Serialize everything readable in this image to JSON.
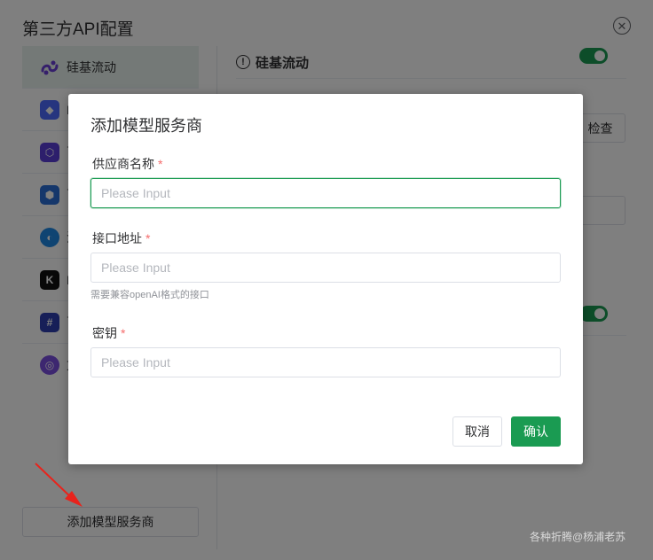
{
  "panel": {
    "title": "第三方API配置",
    "sidebar": {
      "items": [
        {
          "label": "硅基流动",
          "icon": "siliconflow-icon",
          "color": "#6b3fd6",
          "active": true
        },
        {
          "label": "D",
          "icon": "deepseek-icon",
          "color": "#4d6bfe"
        },
        {
          "label": "百",
          "icon": "provider-3-icon",
          "color": "#5b3fd9"
        },
        {
          "label": "百",
          "icon": "provider-4-icon",
          "color": "#2b6fd6"
        },
        {
          "label": "混",
          "icon": "provider-5-icon",
          "color": "#1e88e5"
        },
        {
          "label": "K",
          "icon": "kimi-icon",
          "color": "#111111"
        },
        {
          "label": "百",
          "icon": "provider-7-icon",
          "color": "#2f3fb0"
        },
        {
          "label": "文",
          "icon": "provider-8-icon",
          "color": "#7b4fe0"
        }
      ],
      "add_button": "添加模型服务商"
    },
    "content": {
      "title": "硅基流动",
      "check_button": "检查"
    }
  },
  "dialog": {
    "title": "添加模型服务商",
    "fields": [
      {
        "label": "供应商名称",
        "placeholder": "Please Input",
        "required": "*"
      },
      {
        "label": "接口地址",
        "placeholder": "Please Input",
        "required": "*",
        "hint": "需要兼容openAI格式的接口"
      },
      {
        "label": "密钥",
        "placeholder": "Please Input",
        "required": "*"
      }
    ],
    "cancel": "取消",
    "confirm": "确认"
  },
  "watermark": "各种折腾@杨浦老苏",
  "colors": {
    "accent": "#1a9b52",
    "required": "#f56c6c"
  }
}
